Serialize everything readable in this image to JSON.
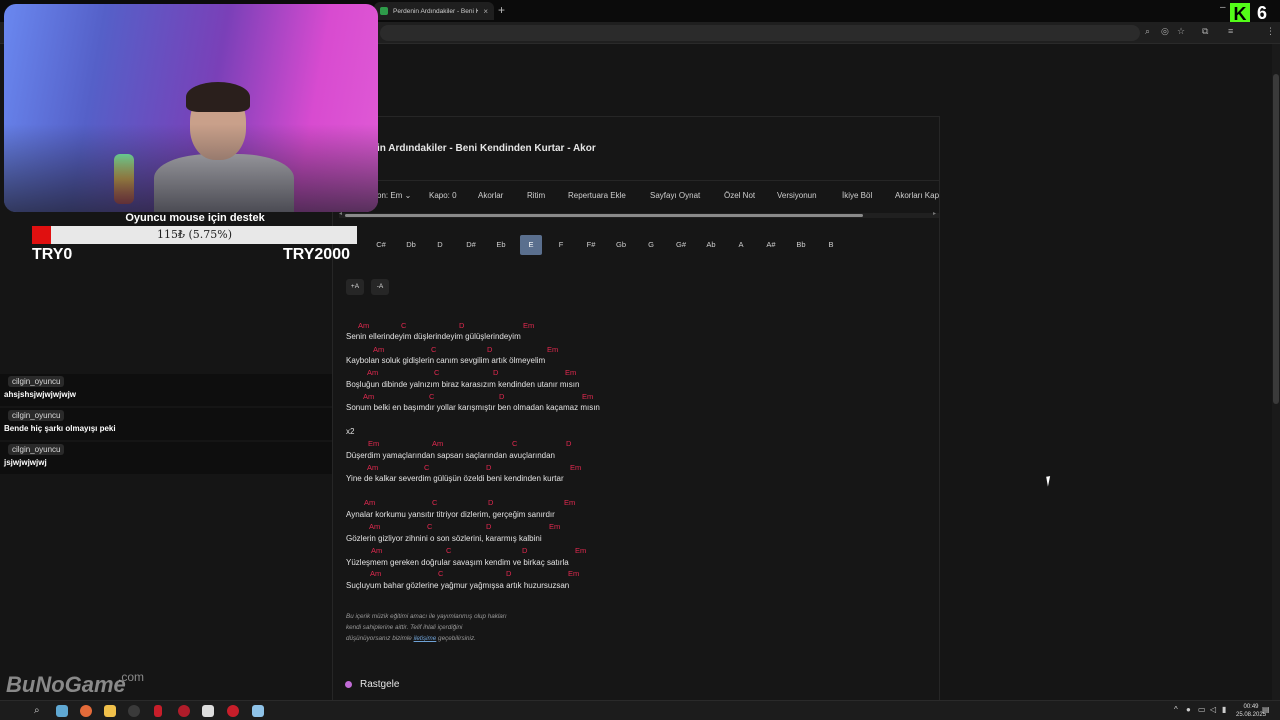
{
  "browser": {
    "tab_title": "Perdenin Ardındakiler - Beni Ku",
    "tab_close": "×",
    "new_tab": "+",
    "kick_logo": "K",
    "kick_count": "6",
    "window_minimize": "–"
  },
  "page": {
    "title": "in Ardındakiler - Beni Kendinden Kurtar - Akor",
    "menu": [
      "on: Em ⌄",
      "Kapo: 0",
      "Akorlar",
      "Ritim",
      "Repertuara Ekle",
      "Sayfayı Oynat",
      "Özel Not",
      "Versiyonun",
      "İkiye Böl",
      "Akorları Kap"
    ],
    "keys": [
      "C#",
      "Db",
      "D",
      "D#",
      "Eb",
      "E",
      "F",
      "F#",
      "Gb",
      "G",
      "G#",
      "Ab",
      "A",
      "A#",
      "Bb",
      "B"
    ],
    "active_key": "E",
    "font_buttons": [
      "+A",
      "-A"
    ],
    "scroll_left": "◂",
    "scroll_right": "▸"
  },
  "song": {
    "verse1": [
      {
        "chords": [
          "Am",
          "C",
          "D",
          "Em"
        ],
        "lyric": "Senin ellerindeyim düşlerindeyim gülüşlerindeyim"
      },
      {
        "chords": [
          "Am",
          "C",
          "D",
          "Em"
        ],
        "lyric": "Kaybolan soluk gidişlerin canım sevgilim artık ölmeyelim"
      },
      {
        "chords": [
          "Am",
          "C",
          "D",
          "Em"
        ],
        "lyric": "Boşluğun dibinde yalnızım biraz karasızım kendinden utanır mısın"
      },
      {
        "chords": [
          "Am",
          "C",
          "D",
          "Em"
        ],
        "lyric": "Sonum belki en başımdır yollar karışmıştır ben olmadan kaçamaz mısın"
      }
    ],
    "repeat_marker": "x2",
    "chorus": [
      {
        "chords": [
          "Em",
          "Am",
          "C",
          "D"
        ],
        "lyric": "Düşerdim yamaçlarından    sapsarı saçlarından avuçlarından"
      },
      {
        "chords": [
          "Am",
          "C",
          "D",
          "Em"
        ],
        "lyric": "Yine de kalkar severdim gülüşün özeldi  beni kendinden kurtar"
      }
    ],
    "verse2": [
      {
        "chords": [
          "Am",
          "C",
          "D",
          "Em"
        ],
        "lyric": "Aynalar korkumu yansıtır titriyor dizlerim, gerçeğim sanırdır"
      },
      {
        "chords": [
          "Am",
          "C",
          "D",
          "Em"
        ],
        "lyric": "Gözlerin gizliyor zihnini o son sözlerini, kararmış kalbini"
      },
      {
        "chords": [
          "Am",
          "C",
          "D",
          "Em"
        ],
        "lyric": "Yüzleşmem gereken doğrular savaşım kendim ve birkaç satırla"
      },
      {
        "chords": [
          "Am",
          "C",
          "D",
          "Em"
        ],
        "lyric": "Suçluyum bahar gözlerine yağmur yağmışsa artık huzursuzsan"
      }
    ],
    "disclaimer_line1": "Bu içerik müzik eğitimi amacı ile yayımlanmış olup hakları",
    "disclaimer_line2": "kendi sahiplerine aittir. Telif ihlali içerdiğini",
    "disclaimer_line3_pre": "düşünüyorsanız bizimle ",
    "disclaimer_link": "iletişime",
    "disclaimer_line3_post": " geçebilirsiniz.",
    "random_label": "Rastgele"
  },
  "overlay": {
    "donation_title": "Oyuncu mouse için destek",
    "donation_progress_text": "115₺ (5.75%)",
    "donation_progress": 0.0575,
    "donation_min": "TRY0",
    "donation_max": "TRY2000",
    "watermark": "BuNoGame",
    "watermark_suffix": ".com",
    "chat": [
      {
        "user": "cilgin_oyuncu",
        "text": "ahsjshsjwjwjwjwjw"
      },
      {
        "user": "cilgin_oyuncu",
        "text": "Bende hiç şarkı olmayışı peki"
      },
      {
        "user": "cilgin_oyuncu",
        "text": "jsjwjwjwjwj"
      }
    ]
  },
  "taskbar": {
    "time": "00:49",
    "date": "25.08.2025"
  },
  "colors": {
    "chord": "#e0294f",
    "active_key": "#5a6f8e",
    "donation_fill": "#e01010",
    "random_dot": "#c16bd6"
  }
}
